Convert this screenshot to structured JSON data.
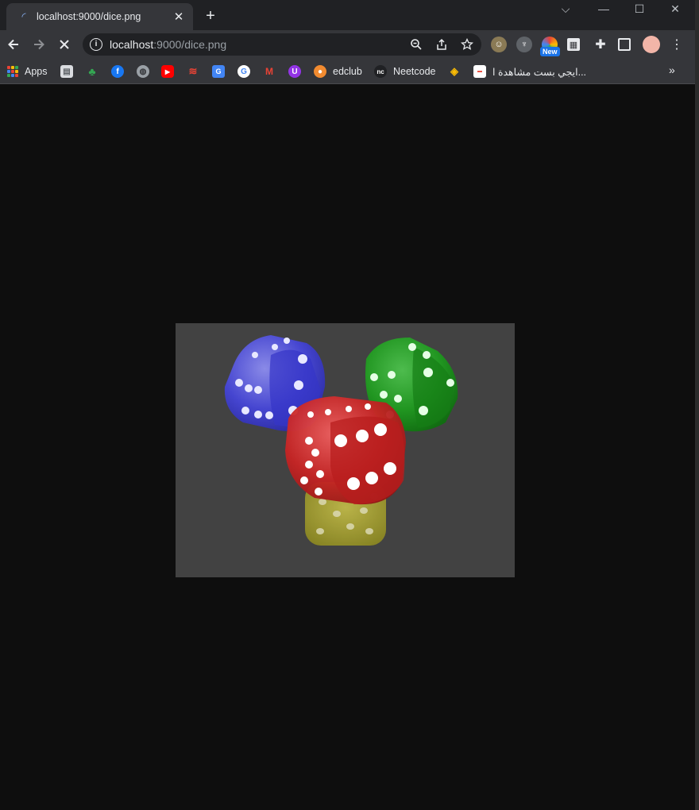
{
  "tab": {
    "title": "localhost:9000/dice.png",
    "close_glyph": "✕",
    "new_tab_glyph": "+"
  },
  "window_controls": {
    "tab_search": "⌵",
    "minimize": "—",
    "maximize": "☐",
    "close": "✕"
  },
  "toolbar": {
    "url_host": "localhost",
    "url_rest": ":9000/dice.png",
    "ext_badge": "New"
  },
  "bookmarks": {
    "apps_label": "Apps",
    "items": [
      {
        "label": "edclub",
        "icon": "edclub-icon"
      },
      {
        "label": "Neetcode",
        "icon": "neetcode-icon"
      },
      {
        "label": "ايجي بست مشاهدة ا...",
        "icon": "egybest-icon"
      }
    ],
    "more_glyph": "»"
  },
  "content": {
    "image_alt": "dice",
    "background_color": "#0e0e0e",
    "image_background": "#424242"
  }
}
